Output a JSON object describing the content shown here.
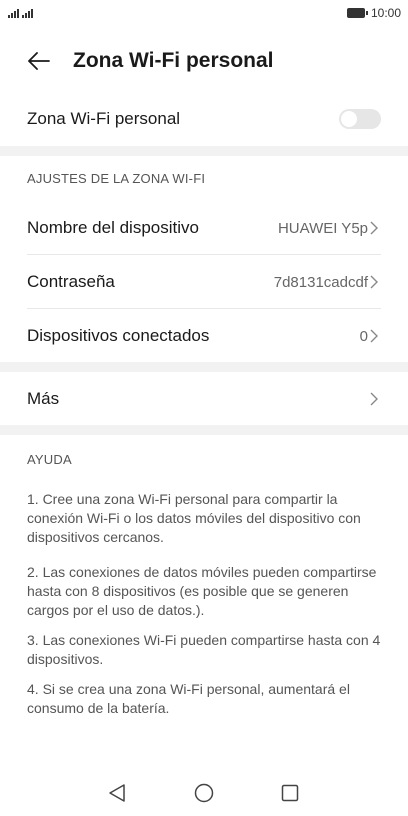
{
  "status_bar": {
    "signal_icons": [
      "signal-icon",
      "signal-icon"
    ],
    "battery_icon": "battery-icon",
    "time": "10:00"
  },
  "header": {
    "back_icon": "arrow-left-icon",
    "title": "Zona Wi-Fi personal"
  },
  "hotspot_toggle": {
    "label": "Zona Wi-Fi personal",
    "enabled": false
  },
  "settings_section": {
    "header": "AJUSTES DE LA ZONA WI-FI",
    "items": [
      {
        "label": "Nombre del dispositivo",
        "value": "HUAWEI Y5p"
      },
      {
        "label": "Contraseña",
        "value": "7d8131cadcdf"
      },
      {
        "label": "Dispositivos conectados",
        "value": "0"
      }
    ]
  },
  "more": {
    "label": "Más"
  },
  "help_section": {
    "header": "AYUDA",
    "items": [
      "1. Cree una zona Wi-Fi personal para compartir la conexión Wi-Fi o los datos móviles del dispositivo con dispositivos cercanos.",
      "2. Las conexiones de datos móviles pueden compartirse hasta con 8 dispositivos (es posible que se generen cargos por el uso de datos.).",
      "3. Las conexiones Wi-Fi pueden compartirse hasta con 4 dispositivos.",
      "4. Si se crea una zona Wi-Fi personal, aumentará el consumo de la batería."
    ]
  },
  "nav_bar": {
    "back_icon": "triangle-back-icon",
    "home_icon": "circle-home-icon",
    "recents_icon": "square-recents-icon"
  },
  "colors": {
    "background": "#ffffff",
    "section_gap": "#f2f2f2",
    "toggle_off": "#e6e6e6",
    "secondary_text": "#666666"
  }
}
